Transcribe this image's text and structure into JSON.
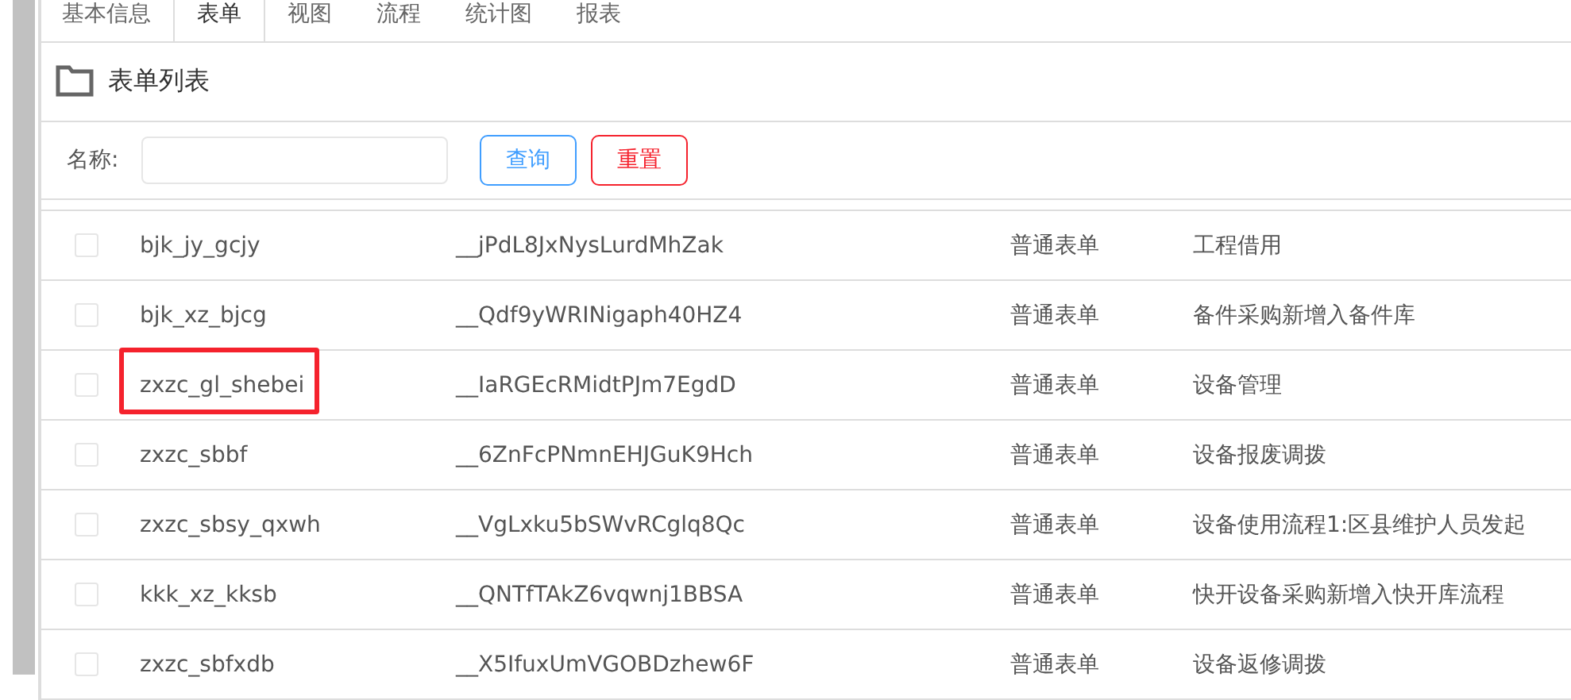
{
  "tabs": [
    {
      "label": "基本信息",
      "selected": false
    },
    {
      "label": "表单",
      "selected": true
    },
    {
      "label": "视图",
      "selected": false
    },
    {
      "label": "流程",
      "selected": false
    },
    {
      "label": "统计图",
      "selected": false
    },
    {
      "label": "报表",
      "selected": false
    }
  ],
  "panel": {
    "title": "表单列表"
  },
  "search": {
    "label": "名称:",
    "buttons": [
      {
        "label": "查询",
        "kind": "primary"
      },
      {
        "label": "重置",
        "kind": "danger"
      }
    ]
  },
  "table": {
    "rows": [
      {
        "checked": false,
        "highlighted": false,
        "cells": [
          "bjk_jy_gcjy",
          "__jPdL8JxNysLurdMhZak",
          "普通表单",
          "工程借用"
        ]
      },
      {
        "checked": false,
        "highlighted": false,
        "cells": [
          "bjk_xz_bjcg",
          "__Qdf9yWRINigaph40HZ4",
          "普通表单",
          "备件采购新增入备件库"
        ]
      },
      {
        "checked": false,
        "highlighted": true,
        "cells": [
          "zxzc_gl_shebei",
          "__IaRGEcRMidtPJm7EgdD",
          "普通表单",
          "设备管理"
        ]
      },
      {
        "checked": false,
        "highlighted": false,
        "cells": [
          "zxzc_sbbf",
          "__6ZnFcPNmnEHJGuK9Hch",
          "普通表单",
          "设备报废调拨"
        ]
      },
      {
        "checked": false,
        "highlighted": false,
        "cells": [
          "zxzc_sbsy_qxwh",
          "__VgLxku5bSWvRCglq8Qc",
          "普通表单",
          "设备使用流程1:区县维护人员发起"
        ]
      },
      {
        "checked": false,
        "highlighted": false,
        "cells": [
          "kkk_xz_kksb",
          "__QNTfTAkZ6vqwnj1BBSA",
          "普通表单",
          "快开设备采购新增入快开库流程"
        ]
      },
      {
        "checked": false,
        "highlighted": false,
        "cells": [
          "zxzc_sbfxdb",
          "__X5IfuxUmVGOBDzhew6F",
          "普通表单",
          "设备返修调拨"
        ]
      }
    ]
  }
}
